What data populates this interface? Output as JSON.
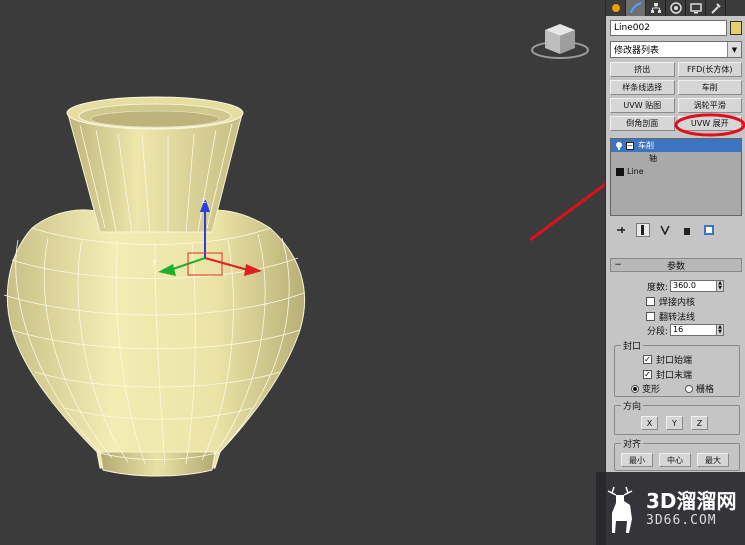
{
  "command_panel": {
    "tabs": [
      "create-icon",
      "modify-icon",
      "hierarchy-icon",
      "motion-icon",
      "display-icon",
      "utilities-icon"
    ],
    "object_name": "Line002",
    "object_color": "#e8cf6e",
    "modifier_list": "修改器列表",
    "modifier_buttons": [
      "挤出",
      "FFD(长方体)",
      "样条线选择",
      "车削",
      "UVW 贴图",
      "涡轮平滑",
      "倒角剖面",
      "UVW 展开"
    ],
    "stack": {
      "selected": "车削",
      "sub": "轴",
      "base": "Line"
    },
    "parameters": {
      "title": "参数",
      "degrees_label": "度数:",
      "degrees_value": "360.0",
      "weld_core": "焊接内核",
      "flip_normals": "翻转法线",
      "segments_label": "分段:",
      "segments_value": "16",
      "capping": {
        "title": "封口",
        "cap_start": "封口始端",
        "cap_end": "封口末端",
        "morph": "变形",
        "grid": "栅格"
      },
      "direction": {
        "title": "方向",
        "x": "X",
        "y": "Y",
        "z": "Z"
      },
      "align": {
        "title": "对齐",
        "min": "最小",
        "center": "中心",
        "max": "最大"
      }
    }
  },
  "viewport": {
    "axis_labels": {
      "x": "x",
      "y": "y",
      "z": "z"
    }
  },
  "watermark": {
    "cn": "3D溜溜网",
    "en": "3D66.COM"
  },
  "colors": {
    "viewport_bg": "#3b3b3b",
    "vase_fill": "#ece5a8",
    "annotation_red": "#e0101a",
    "stack_selection": "#3c74c2"
  }
}
